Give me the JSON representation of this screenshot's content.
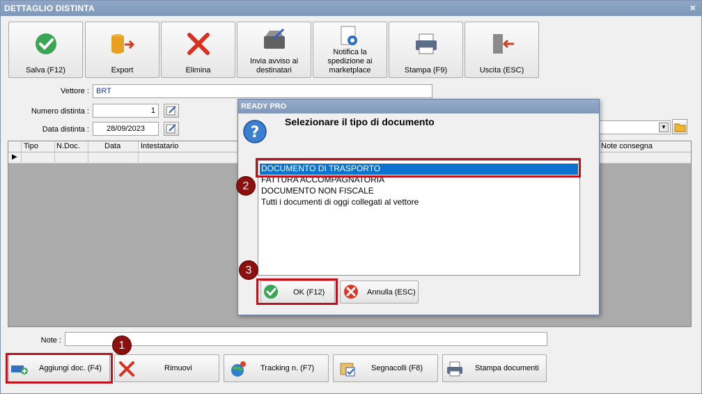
{
  "window": {
    "title": "DETTAGLIO DISTINTA",
    "close": "×"
  },
  "toolbar": [
    {
      "label": "Salva (F12)",
      "icon": "check-circle-icon"
    },
    {
      "label": "Export",
      "icon": "export-database-icon"
    },
    {
      "label": "Elimina",
      "icon": "delete-x-icon"
    },
    {
      "label": "Invia avviso ai destinatari",
      "icon": "send-notice-icon"
    },
    {
      "label": "Notifica la spedizione ai marketplace",
      "icon": "notify-marketplace-icon"
    },
    {
      "label": "Stampa (F9)",
      "icon": "printer-icon"
    },
    {
      "label": "Uscita (ESC)",
      "icon": "exit-door-icon"
    }
  ],
  "form": {
    "vettore_label": "Vettore :",
    "vettore_value": "BRT",
    "numero_label": "Numero distinta :",
    "numero_value": "1",
    "data_label": "Data distinta :",
    "data_value": "28/09/2023"
  },
  "grid": {
    "columns": [
      "Tipo",
      "N.Doc.",
      "Data",
      "Intestatario",
      "Note consegna"
    ]
  },
  "note": {
    "label": "Note :",
    "value": ""
  },
  "bottom_buttons": [
    {
      "label": "Aggiungi doc. (F4)",
      "icon": "add-document-icon"
    },
    {
      "label": "Rimuovi",
      "icon": "remove-x-icon"
    },
    {
      "label": "Tracking n. (F7)",
      "icon": "tracking-globe-icon"
    },
    {
      "label": "Segnacolli (F8)",
      "icon": "parcel-labels-icon"
    },
    {
      "label": "Stampa documenti",
      "icon": "printer-icon"
    }
  ],
  "dialog": {
    "title": "READY PRO",
    "question": "Selezionare il tipo di documento",
    "options": [
      "DOCUMENTO DI TRASPORTO",
      "FATTURA ACCOMPAGNATORIA",
      "DOCUMENTO NON FISCALE",
      "Tutti i documenti di oggi collegati al vettore"
    ],
    "selected_index": 0,
    "ok_label": "OK (F12)",
    "cancel_label": "Annulla (ESC)"
  },
  "markers": [
    "1",
    "2",
    "3"
  ],
  "colors": {
    "title_bar": "#8199bb",
    "selection": "#0a73cf",
    "highlight_box": "#c0101a",
    "marker": "#8b1010"
  }
}
